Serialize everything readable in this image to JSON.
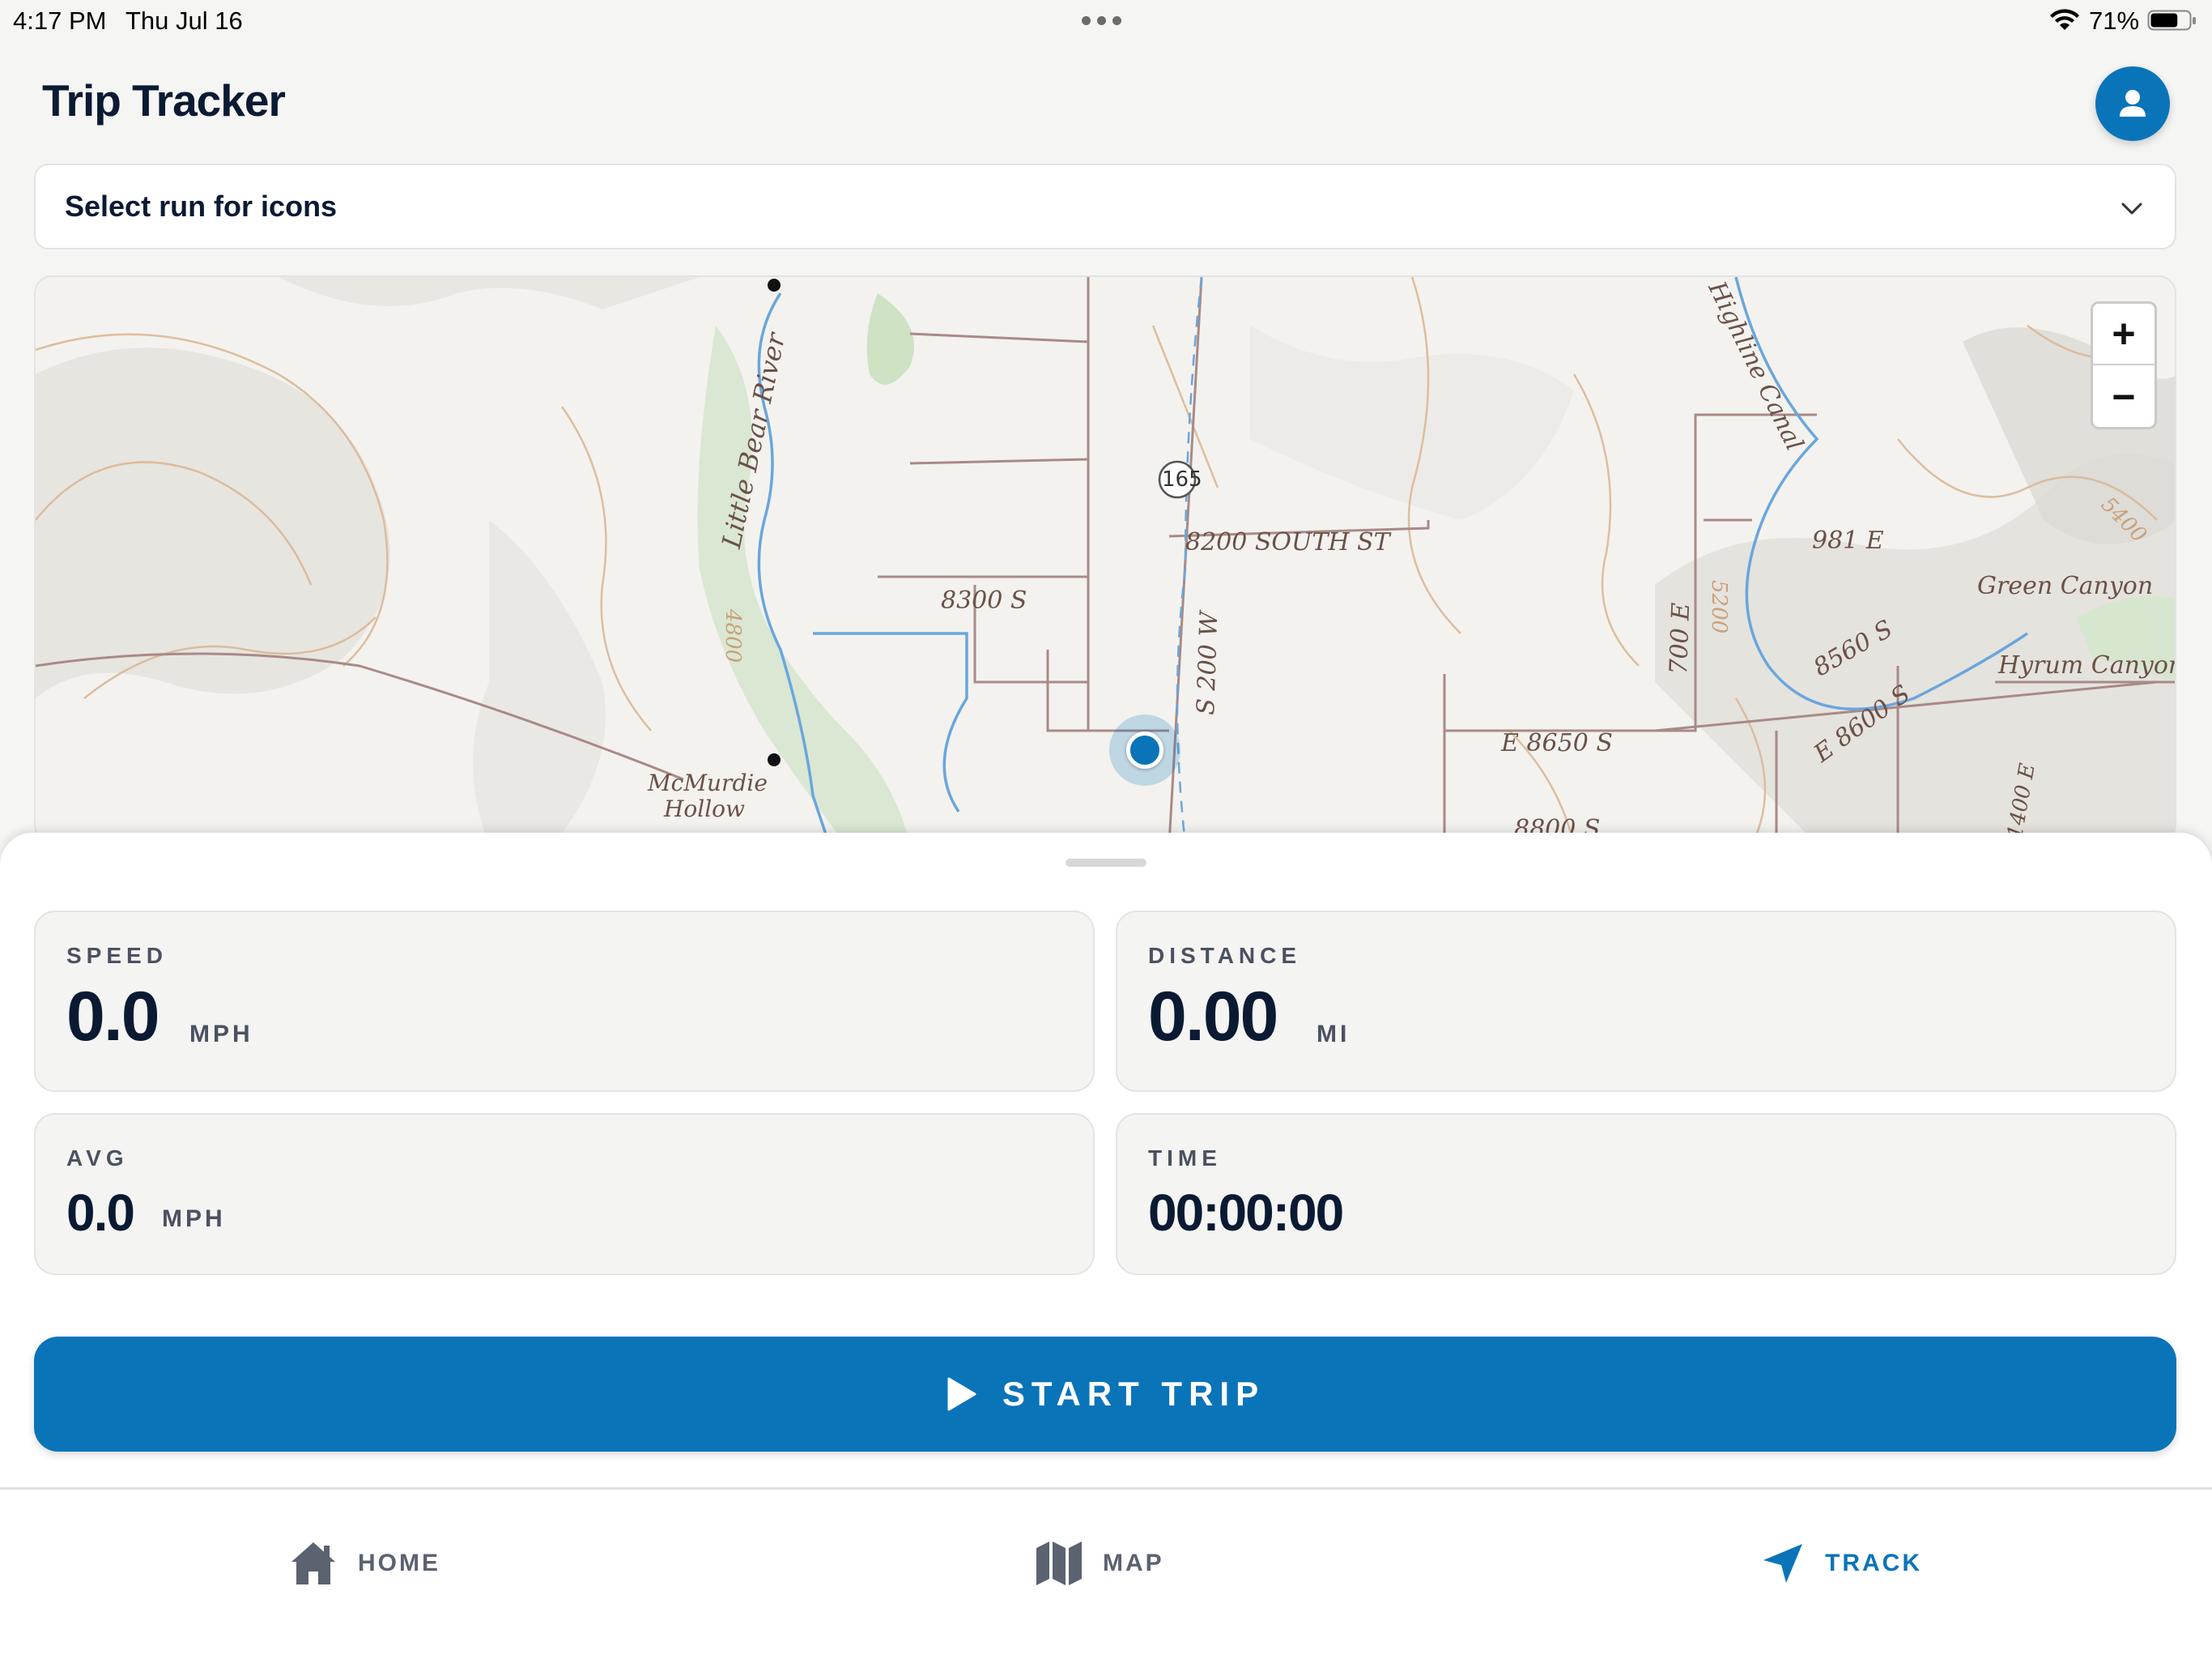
{
  "status_bar": {
    "time": "4:17 PM",
    "date": "Thu Jul 16",
    "battery_percent": "71%",
    "battery_level": 0.71
  },
  "header": {
    "title": "Trip Tracker",
    "profile_icon": "person-icon"
  },
  "run_select": {
    "selected_label": "Select run for icons",
    "icon": "chevron-down-icon"
  },
  "map": {
    "labels": {
      "river": "Little Bear River",
      "canal": "Highline Canal",
      "route": "165",
      "st_8200": "8200 SOUTH ST",
      "st_8300": "8300 S",
      "st_s200w": "S 200 W",
      "elev_4800": "4800",
      "elev_5200": "5200",
      "elev_5400": "5400",
      "st_700e": "700 E",
      "st_981e": "981 E",
      "st_8560": "8560 S",
      "st_8600": "E 8600 S",
      "st_8650": "E 8650 S",
      "st_8800": "8800 S",
      "green_canyon": "Green Canyon",
      "hyrum_canyon": "Hyrum Canyon",
      "mcmurdie": "McMurdie",
      "hollow": "Hollow",
      "st_1400e": "1400 E"
    },
    "zoom_in": "+",
    "zoom_out": "−"
  },
  "stats": {
    "speed": {
      "label": "SPEED",
      "value": "0.0",
      "unit": "MPH"
    },
    "distance": {
      "label": "DISTANCE",
      "value": "0.00",
      "unit": "MI"
    },
    "avg": {
      "label": "AVG",
      "value": "0.0",
      "unit": "MPH"
    },
    "time": {
      "label": "TIME",
      "value": "00:00:00"
    }
  },
  "start_button": {
    "label": "START TRIP",
    "icon": "play-icon"
  },
  "tabs": [
    {
      "label": "HOME",
      "icon": "home-icon",
      "active": false
    },
    {
      "label": "MAP",
      "icon": "map-icon",
      "active": false
    },
    {
      "label": "TRACK",
      "icon": "navigation-arrow-icon",
      "active": true
    }
  ],
  "colors": {
    "accent": "#0a74b9",
    "title": "#0b1a33",
    "background": "#f5f5f4"
  }
}
